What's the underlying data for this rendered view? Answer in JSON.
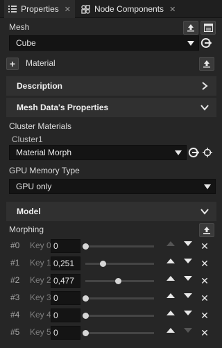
{
  "tabs": [
    {
      "label": "Properties",
      "icon": "list-icon",
      "active": true
    },
    {
      "label": "Node Components",
      "icon": "components-icon",
      "active": false
    }
  ],
  "mesh": {
    "label": "Mesh",
    "value": "Cube"
  },
  "material": {
    "label": "Material"
  },
  "sections": {
    "description": "Description",
    "mesh_data": "Mesh Data's Properties",
    "model": "Model"
  },
  "cluster": {
    "title": "Cluster Materials",
    "sub": "Cluster1",
    "value": "Material Morph"
  },
  "gpu": {
    "label": "GPU Memory Type",
    "value": "GPU only"
  },
  "morphing": {
    "label": "Morphing",
    "rows": [
      {
        "index": "#0",
        "key": "Key 0",
        "value": "0",
        "fraction": 0.0
      },
      {
        "index": "#1",
        "key": "Key 1",
        "value": "0,251",
        "fraction": 0.251
      },
      {
        "index": "#2",
        "key": "Key 2",
        "value": "0,477",
        "fraction": 0.477
      },
      {
        "index": "#3",
        "key": "Key 3",
        "value": "0",
        "fraction": 0.0
      },
      {
        "index": "#4",
        "key": "Key 4",
        "value": "0",
        "fraction": 0.0
      },
      {
        "index": "#5",
        "key": "Key 5",
        "value": "0",
        "fraction": 0.0
      }
    ]
  },
  "colors": {
    "background": "#262626",
    "input": "#141414",
    "section": "#303030"
  }
}
